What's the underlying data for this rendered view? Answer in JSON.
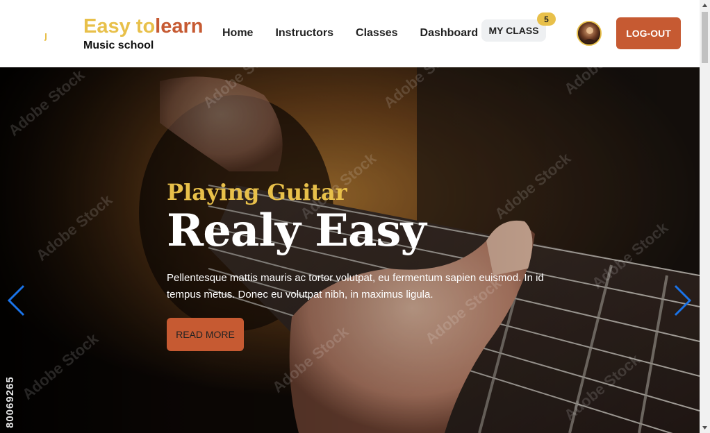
{
  "brand": {
    "title_part1": "Easy to",
    "title_part2": "learn",
    "subtitle": "Music school"
  },
  "nav": {
    "links": [
      {
        "label": "Home"
      },
      {
        "label": "Instructors"
      },
      {
        "label": "Classes"
      },
      {
        "label": "Dashboard"
      }
    ],
    "my_class_label": "MY CLASS",
    "my_class_count": "5",
    "logout_label": "LOG-OUT",
    "avatar_icon": "user-avatar"
  },
  "hero": {
    "kicker": "Playing Guitar",
    "title": "Realy Easy",
    "text": "Pellentesque mattis mauris ac tortor volutpat, eu fermentum sapien euismod. In id tempus metus. Donec eu volutpat nibh, in maximus ligula.",
    "button_label": "READ MORE",
    "prev_icon": "chevron-left-icon",
    "next_icon": "chevron-right-icon",
    "watermark": "Adobe Stock",
    "stock_id": "80069265"
  },
  "colors": {
    "accent_yellow": "#e8c04a",
    "accent_orange": "#c65a32",
    "arrow_blue": "#1a73e8"
  }
}
